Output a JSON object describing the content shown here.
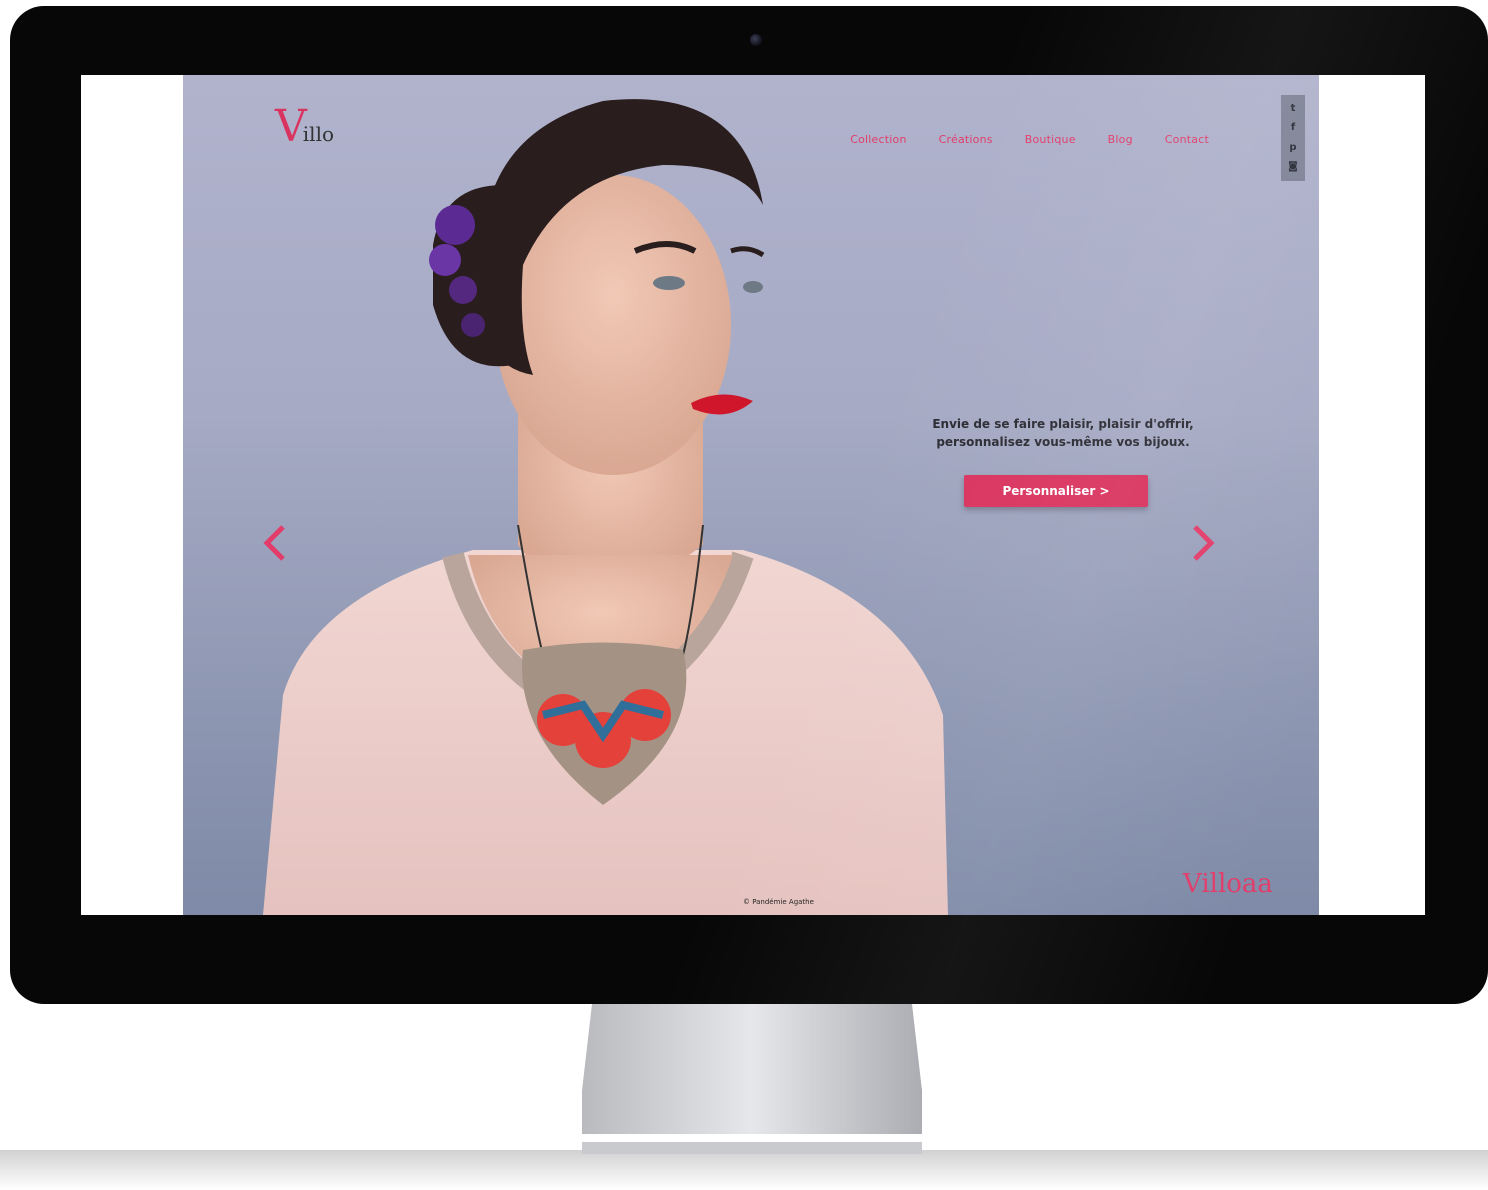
{
  "logo": {
    "initial": "V",
    "rest": "illo"
  },
  "nav": {
    "items": [
      "Collection",
      "Créations",
      "Boutique",
      "Blog",
      "Contact"
    ]
  },
  "social": {
    "icons": [
      "twitter-icon",
      "facebook-icon",
      "pinterest-icon",
      "instagram-icon"
    ],
    "glyphs": [
      "t",
      "f",
      "p",
      "◙"
    ]
  },
  "hero": {
    "tagline_line1": "Envie de se faire plaisir, plaisir d'offrir,",
    "tagline_line2": "personnalisez vous-même vos bijoux.",
    "cta_label": "Personnaliser >",
    "credit": "© Pandémie Agathe",
    "watermark": "Villoaa"
  },
  "colors": {
    "accent": "#d9345f",
    "background_top": "#b1b3cd",
    "background_bottom": "#7e8aa7"
  }
}
